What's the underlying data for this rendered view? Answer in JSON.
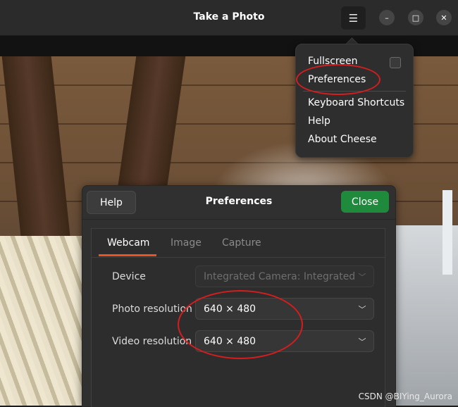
{
  "window": {
    "title": "Take a Photo",
    "menu_icon": "hamburger-icon",
    "controls": {
      "minimize": "minimize-icon",
      "maximize": "maximize-icon",
      "close": "close-icon"
    }
  },
  "menu": {
    "items": [
      "Fullscreen",
      "Preferences",
      "Keyboard Shortcuts",
      "Help",
      "About Cheese"
    ],
    "fullscreen_checked": false
  },
  "preferences": {
    "help_label": "Help",
    "title": "Preferences",
    "close_label": "Close",
    "tabs": [
      "Webcam",
      "Image",
      "Capture"
    ],
    "active_tab": "Webcam",
    "device_label": "Device",
    "device_value": "Integrated Camera: Integrated C",
    "photo_resolution_label": "Photo resolution",
    "photo_resolution_value": "640 × 480",
    "video_resolution_label": "Video resolution",
    "video_resolution_value": "640 × 480"
  },
  "colors": {
    "close_button": "#1f8a3b",
    "tab_accent": "#e95420",
    "annotation": "#d41e1e"
  },
  "watermark": "CSDN @BIYing_Aurora"
}
